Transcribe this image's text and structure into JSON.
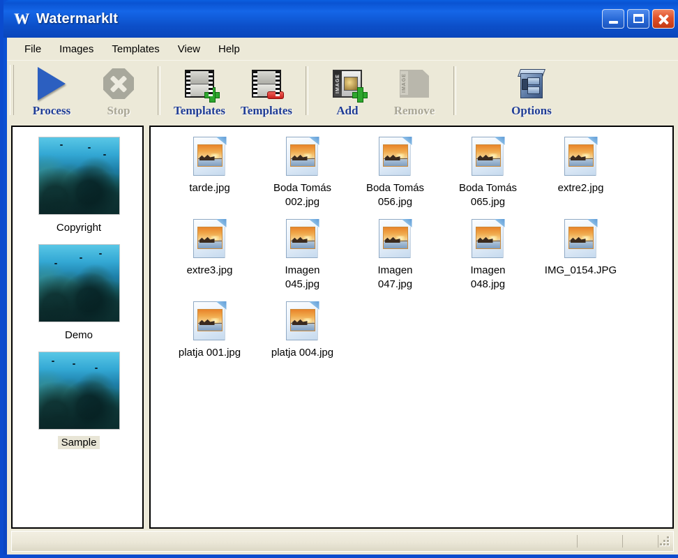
{
  "window": {
    "title": "WatermarkIt",
    "app_icon": "watermark-logo-icon",
    "controls": {
      "minimize": "Minimize",
      "maximize": "Maximize",
      "close": "Close"
    }
  },
  "menubar": {
    "items": [
      {
        "label": "File"
      },
      {
        "label": "Images"
      },
      {
        "label": "Templates"
      },
      {
        "label": "View"
      },
      {
        "label": "Help"
      }
    ]
  },
  "toolbar": {
    "buttons": [
      {
        "label": "Process",
        "icon": "play-triangle-icon",
        "enabled": true
      },
      {
        "label": "Stop",
        "icon": "stop-octagon-icon",
        "enabled": false
      },
      {
        "label": "Templates",
        "icon": "film-add-icon",
        "enabled": true
      },
      {
        "label": "Templates",
        "icon": "film-remove-icon",
        "enabled": true
      },
      {
        "label": "Add",
        "icon": "image-add-icon",
        "enabled": true
      },
      {
        "label": "Remove",
        "icon": "image-remove-icon",
        "enabled": false
      },
      {
        "label": "Options",
        "icon": "filing-cabinet-icon",
        "enabled": true
      }
    ]
  },
  "templates_panel": {
    "items": [
      {
        "label": "Copyright",
        "selected": false,
        "thumbnail": "coral-reef-thumbnail"
      },
      {
        "label": "Demo",
        "selected": false,
        "thumbnail": "coral-reef-thumbnail"
      },
      {
        "label": "Sample",
        "selected": true,
        "thumbnail": "coral-reef-thumbnail"
      }
    ]
  },
  "files_panel": {
    "items": [
      {
        "name": "tarde.jpg",
        "icon": "jpeg-file-icon"
      },
      {
        "name": "Boda Tomás\n002.jpg",
        "icon": "jpeg-file-icon"
      },
      {
        "name": "Boda Tomás\n056.jpg",
        "icon": "jpeg-file-icon"
      },
      {
        "name": "Boda Tomás\n065.jpg",
        "icon": "jpeg-file-icon"
      },
      {
        "name": "extre2.jpg",
        "icon": "jpeg-file-icon"
      },
      {
        "name": "extre3.jpg",
        "icon": "jpeg-file-icon"
      },
      {
        "name": "Imagen\n045.jpg",
        "icon": "jpeg-file-icon"
      },
      {
        "name": "Imagen\n047.jpg",
        "icon": "jpeg-file-icon"
      },
      {
        "name": "Imagen\n048.jpg",
        "icon": "jpeg-file-icon"
      },
      {
        "name": "IMG_0154.JPG",
        "icon": "jpeg-file-icon"
      },
      {
        "name": "platja 001.jpg",
        "icon": "jpeg-file-icon"
      },
      {
        "name": "platja 004.jpg",
        "icon": "jpeg-file-icon"
      }
    ]
  },
  "statusbar": {
    "panes": [
      "",
      "",
      ""
    ],
    "resize_grip": "resize-grip-icon"
  },
  "colors": {
    "titlebar_blue": "#0A52D6",
    "window_frame": "#0A4BCE",
    "face_beige": "#ECE9D8",
    "toolbar_label_blue": "#1F3C95",
    "close_button_red": "#E0502A",
    "panel_white": "#FFFFFF",
    "selection_highlight": "#E8E5D6"
  }
}
